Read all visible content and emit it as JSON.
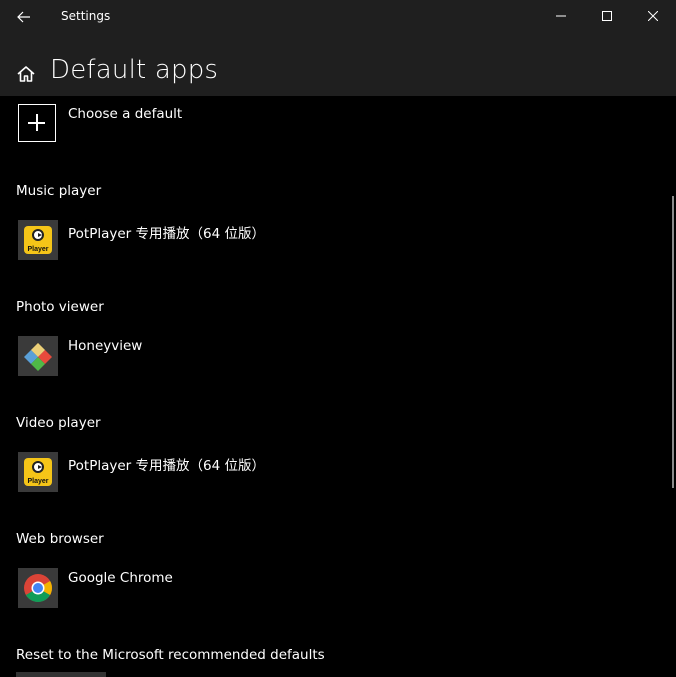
{
  "window": {
    "title": "Settings",
    "controls": [
      "minimize",
      "maximize",
      "close"
    ]
  },
  "header": {
    "page_title": "Default apps"
  },
  "choose_default": {
    "label": "Choose a default"
  },
  "sections": [
    {
      "heading": "Music player",
      "app_name": "PotPlayer 专用播放（64 位版）",
      "icon": "potplayer-icon"
    },
    {
      "heading": "Photo viewer",
      "app_name": "Honeyview",
      "icon": "honeyview-icon"
    },
    {
      "heading": "Video player",
      "app_name": "PotPlayer 专用播放（64 位版）",
      "icon": "potplayer-icon"
    },
    {
      "heading": "Web browser",
      "app_name": "Google Chrome",
      "icon": "chrome-icon"
    }
  ],
  "reset": {
    "label": "Reset to the Microsoft recommended defaults"
  },
  "icons": {
    "potplayer_text": "Player"
  },
  "colors": {
    "titlebar": "#1f1f1f",
    "background": "#000000",
    "potplayer_yellow": "#f5c518"
  }
}
